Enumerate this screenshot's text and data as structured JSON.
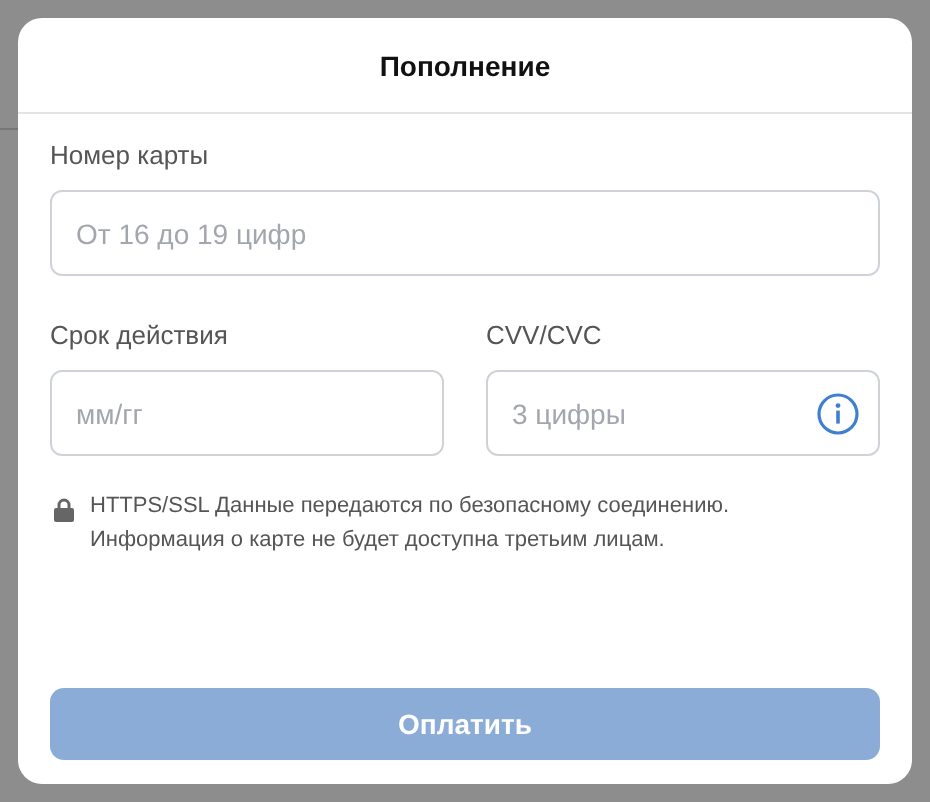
{
  "dialog": {
    "title": "Пополнение",
    "card_number": {
      "label": "Номер карты",
      "placeholder": "От 16 до 19 цифр"
    },
    "expiry": {
      "label": "Срок действия",
      "placeholder": "мм/гг"
    },
    "cvv": {
      "label": "CVV/CVC",
      "placeholder": "3 цифры"
    },
    "security_note": "HTTPS/SSL Данные передаются по безопасному соединению. Информация о карте не будет доступна третьим лицам.",
    "pay_button": {
      "label": "Оплатить",
      "disabled": true
    }
  }
}
